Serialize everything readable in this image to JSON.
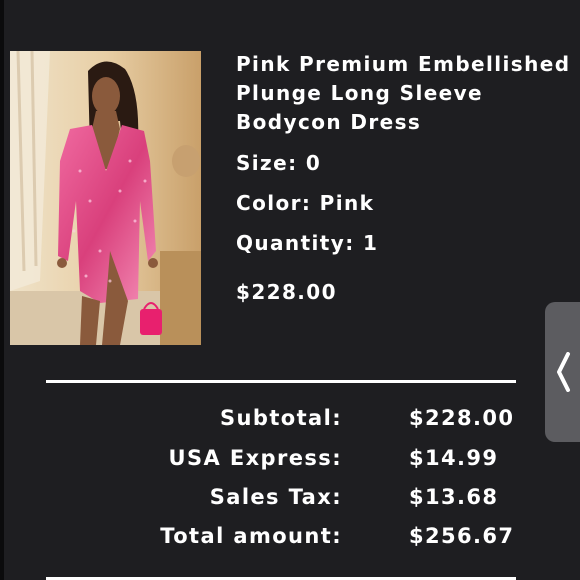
{
  "product": {
    "title_lines": [
      "Pink Premium Embellished",
      "Plunge Long Sleeve",
      "Bodycon Dress"
    ],
    "size": "Size: 0",
    "color": "Color: Pink",
    "quantity": "Quantity: 1",
    "price": "$228.00"
  },
  "summary": [
    {
      "label": "Subtotal:",
      "value": "$228.00"
    },
    {
      "label": "USA Express:",
      "value": "$14.99"
    },
    {
      "label": "Sales Tax:",
      "value": "$13.68"
    },
    {
      "label": "Total amount:",
      "value": "$256.67"
    }
  ],
  "side_handle": {
    "icon": "chevron-left-icon"
  },
  "colors": {
    "background": "#1e1e21",
    "text": "#ffffff",
    "accent_pink": "#e0457f"
  }
}
